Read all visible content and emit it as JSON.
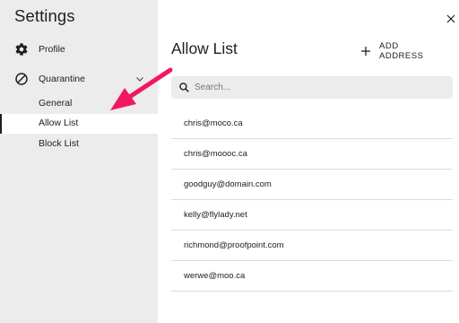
{
  "sidebar": {
    "title": "Settings",
    "items": [
      {
        "label": "Profile",
        "icon": "gear-icon"
      },
      {
        "label": "Quarantine",
        "icon": "block-icon",
        "expanded": true
      }
    ],
    "sub_items": [
      {
        "label": "General",
        "active": false
      },
      {
        "label": "Allow List",
        "active": true
      },
      {
        "label": "Block List",
        "active": false
      }
    ]
  },
  "main": {
    "title": "Allow List",
    "add_button_label": "ADD ADDRESS",
    "search_placeholder": "Search...",
    "entries": [
      "chris@moco.ca",
      "chris@moooc.ca",
      "goodguy@domain.com",
      "kelly@flylady.net",
      "richmond@proofpoint.com",
      "werwe@moo.ca"
    ]
  },
  "colors": {
    "sidebar_bg": "#ececec",
    "annotation_arrow": "#f0195f",
    "divider": "#dcdcdc"
  }
}
